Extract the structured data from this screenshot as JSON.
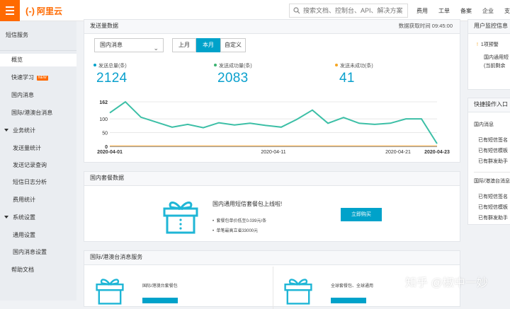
{
  "brand": {
    "logo_mark": "(-)",
    "name": "阿里云"
  },
  "search": {
    "placeholder": "搜索文档、控制台、API、解决方案"
  },
  "topnav": [
    "费用",
    "工单",
    "备案",
    "企业",
    "支"
  ],
  "sidebar": {
    "title": "短信服务",
    "items": [
      "概览",
      "快速学习",
      "国内消息",
      "国际/港澳台消息",
      "业务统计",
      "发送量统计",
      "发送记录查询",
      "短信日志分析",
      "费用统计",
      "系统设置",
      "通用设置",
      "国内消息设置",
      "帮助文档"
    ],
    "badge": "NEW"
  },
  "send_panel": {
    "title": "发送量数据",
    "fetch_time": "数据获取时间 09:45:00",
    "select_value": "国内消息",
    "segments": [
      "上月",
      "本月",
      "自定义"
    ],
    "active_segment": "本月",
    "stats": [
      {
        "label": "发送总量(条)",
        "value": "2124",
        "color": "#00a2ca"
      },
      {
        "label": "发送成功量(条)",
        "value": "2083",
        "color": "#3cb371"
      },
      {
        "label": "发送未成功(条)",
        "value": "41",
        "color": "#f5a623"
      }
    ]
  },
  "chart_data": {
    "type": "line",
    "x_tick_labels": [
      "2020-04-01",
      "2020-04-11",
      "2020-04-21",
      "2020-04-23"
    ],
    "y_tick_labels": [
      "162",
      "100",
      "50",
      "0"
    ],
    "ylim": [
      0,
      162
    ],
    "grid": true,
    "series": [
      {
        "color": "#3cbfa6",
        "values": [
          122,
          162,
          106,
          88,
          70,
          80,
          68,
          86,
          78,
          84,
          76,
          70,
          98,
          132,
          84,
          105,
          84,
          80,
          84,
          100,
          100,
          10
        ]
      },
      {
        "color": "#f5c37a",
        "values": [
          2,
          2,
          2,
          2,
          2,
          2,
          2,
          2,
          2,
          2,
          2,
          2,
          2,
          2,
          2,
          2,
          2,
          2,
          2,
          2,
          2,
          2
        ]
      }
    ]
  },
  "domestic_package": {
    "title": "国内套餐数据",
    "headline": "国内通用短信套餐包上线啦!",
    "bullets": [
      "套餐包单价低至0.039元/条",
      "单笔最高立省33000元"
    ],
    "buy_label": "立即购买"
  },
  "intl_panel": {
    "title": "国际/港澳台消息服务",
    "left_label": "国际/港澳台套餐包",
    "right_label": "全球套餐包、全球通用"
  },
  "right_panels": {
    "monitor_title": "用户监控信息",
    "monitor_alert": "1项预警",
    "monitor_lines": [
      "国内通用短",
      "(当前剩余"
    ],
    "quick_title": "快捷操作入口",
    "quick_domestic": "国内消息",
    "quick_lines1": [
      "已有短信签名",
      "已有短信模板",
      "已有群发助手"
    ],
    "quick_intl": "国际/港澳台消息",
    "quick_lines2": [
      "已有短信签名",
      "已有短信模板",
      "已有群发助手"
    ]
  },
  "watermark": "知乎 @椒中一妙"
}
